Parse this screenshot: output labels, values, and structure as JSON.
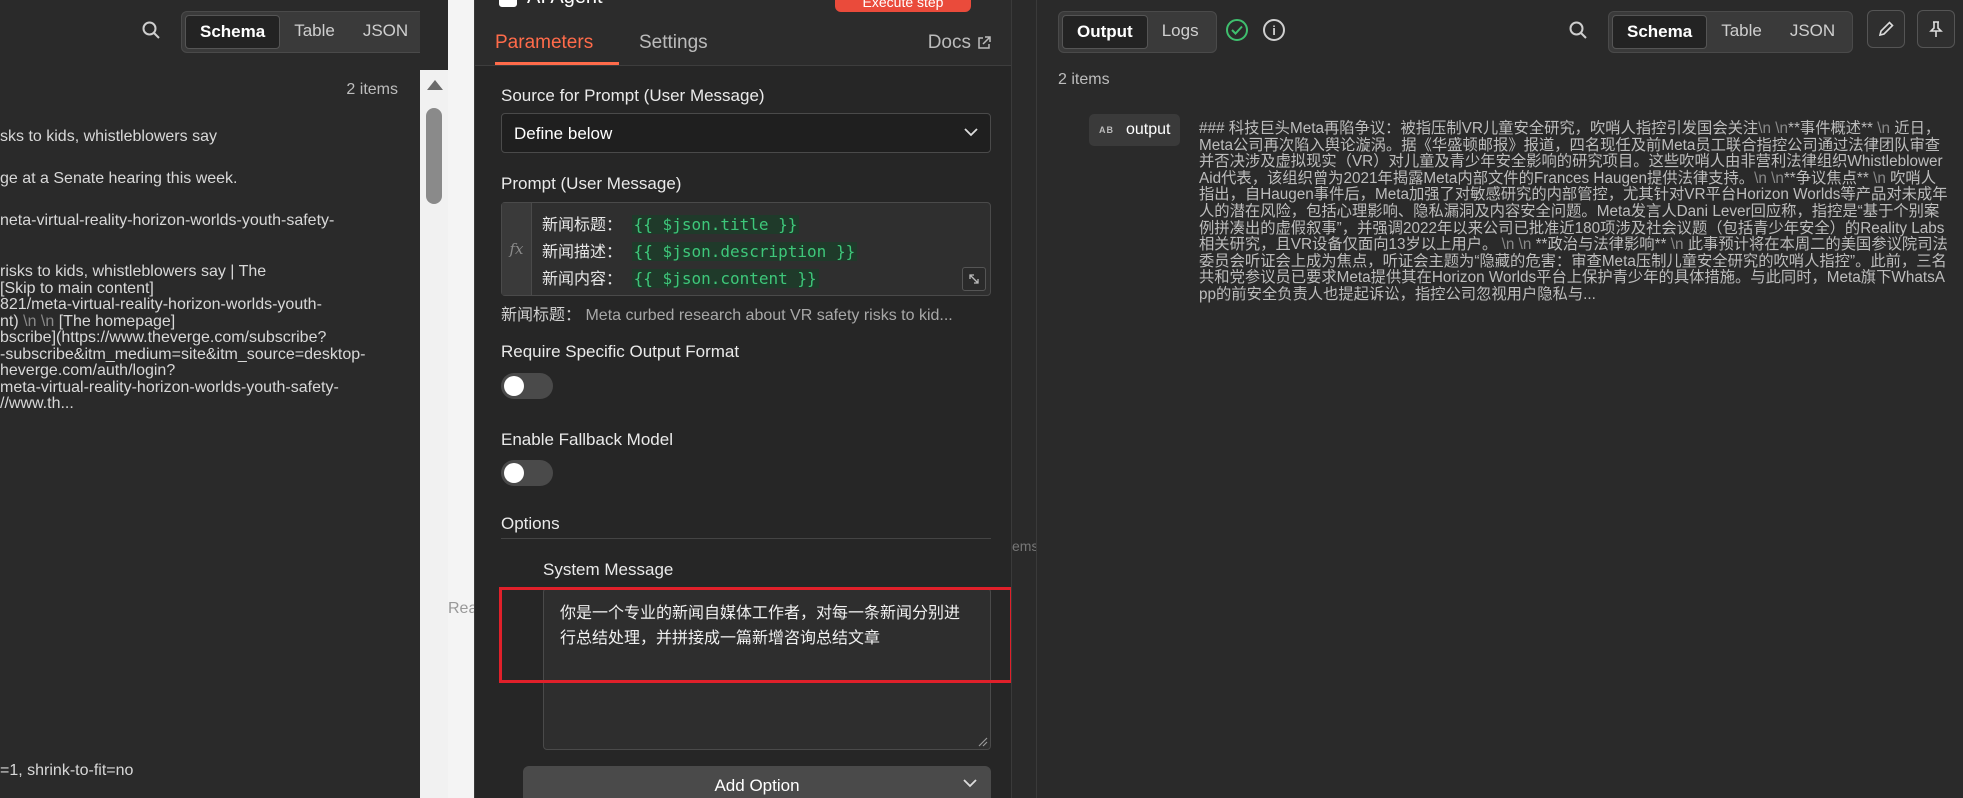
{
  "left_panel": {
    "view_toggle": [
      "Schema",
      "Table",
      "JSON"
    ],
    "active_view": "Schema",
    "items_count": "2 items",
    "lines": [
      {
        "text": "sks to kids, whistleblowers say",
        "escape": ""
      },
      {
        "text": "ge at a Senate hearing this week.",
        "escape": ""
      },
      {
        "text": "neta-virtual-reality-horizon-worlds-youth-safety-",
        "escape": ""
      },
      {
        "text": "risks to kids, whistleblowers say | The",
        "escape": ""
      },
      {
        "text": "[Skip to main content]",
        "escape": ""
      },
      {
        "text": "821/meta-virtual-reality-horizon-worlds-youth-",
        "escape": ""
      },
      {
        "text": "nt)",
        "escape": "\\n \\n",
        "tail": "[The homepage]"
      },
      {
        "text": "bscribe](https://www.theverge.com/subscribe?",
        "escape": ""
      },
      {
        "text": "-subscribe&itm_medium=site&itm_source=desktop-",
        "escape": ""
      },
      {
        "text": "heverge.com/auth/login?",
        "escape": ""
      },
      {
        "text": "meta-virtual-reality-horizon-worlds-youth-safety-",
        "escape": ""
      },
      {
        "text": "//www.th...",
        "escape": ""
      },
      {
        "text": "=1, shrink-to-fit=no",
        "escape": ""
      }
    ]
  },
  "background_canvas": {
    "node_label_fragment": "Rea",
    "edge_label_fragment": "ems"
  },
  "node_panel": {
    "node_title": "AI Agent",
    "execute_label": "Execute step",
    "tabs": [
      "Parameters",
      "Settings"
    ],
    "active_tab": "Parameters",
    "docs_label": "Docs",
    "source_label": "Source for Prompt (User Message)",
    "source_value": "Define below",
    "prompt_label": "Prompt (User Message)",
    "prompt_lines": [
      {
        "prefix": "新闻标题：",
        "expr": "{{ $json.title }}"
      },
      {
        "prefix": "新闻描述：",
        "expr": "{{ $json.description }}"
      },
      {
        "prefix": "新闻内容：",
        "expr": "{{ $json.content }}"
      }
    ],
    "prompt_preview_key": "新闻标题：",
    "prompt_preview_value": "Meta curbed research about VR safety risks to kid...",
    "require_format_label": "Require Specific Output Format",
    "require_format_on": false,
    "fallback_label": "Enable Fallback Model",
    "fallback_on": false,
    "options_label": "Options",
    "system_message_label": "System Message",
    "system_message_value": "你是一个专业的新闻自媒体工作者，对每一条新闻分别进行总结处理，并拼接成一篇新增咨询总结文章",
    "add_option_label": "Add Option"
  },
  "right_panel": {
    "mode_toggle": [
      "Output",
      "Logs"
    ],
    "active_mode": "Output",
    "view_toggle": [
      "Schema",
      "Table",
      "JSON"
    ],
    "active_view": "Schema",
    "items_count": "2 items",
    "output_type_badge": "AB",
    "output_key": "output",
    "output_segments": [
      {
        "t": "### 科技巨头Meta再陷争议：被指压制VR儿童安全研究，吹哨人指控引发国会关注"
      },
      {
        "t": "\\n \\n",
        "esc": true
      },
      {
        "t": "**事件概述**"
      },
      {
        "t": " \\n ",
        "esc": true
      },
      {
        "t": "近日，Meta公司再次陷入舆论漩涡。据《华盛顿邮报》报道，四名现任及前Meta员工联合指控公司通过法律团队审查并否决涉及虚拟现实（VR）对儿童及青少年安全影响的研究项目。这些吹哨人由非营利法律组织Whistleblower Aid代表，该组织曾为2021年揭露Meta内部文件的Frances Haugen提供法律支持。"
      },
      {
        "t": "\\n \\n",
        "esc": true
      },
      {
        "t": "**争议焦点**"
      },
      {
        "t": " \\n ",
        "esc": true
      },
      {
        "t": "吹哨人指出，自Haugen事件后，Meta加强了对敏感研究的内部管控，尤其针对VR平台Horizon Worlds等产品对未成年人的潜在风险，包括心理影响、隐私漏洞及内容安全问题。Meta发言人Dani Lever回应称，指控是“基于个别案例拼凑出的虚假叙事”，并强调2022年以来公司已批准近180项涉及社会议题（包括青少年安全）的Reality Labs相关研究，且VR设备仅面向13岁以上用户。"
      },
      {
        "t": " \\n \\n ",
        "esc": true
      },
      {
        "t": "**政治与法律影响**"
      },
      {
        "t": " \\n ",
        "esc": true
      },
      {
        "t": "此事预计将在本周二的美国参议院司法委员会听证会上成为焦点，听证会主题为“隐藏的危害：审查Meta压制儿童安全研究的吹哨人指控”。此前，三名共和党参议员已要求Meta提供其在Horizon Worlds平台上保护青少年的具体措施。与此同时，Meta旗下WhatsApp的前安全负责人也提起诉讼，指控公司忽视用户隐私与..."
      }
    ]
  }
}
